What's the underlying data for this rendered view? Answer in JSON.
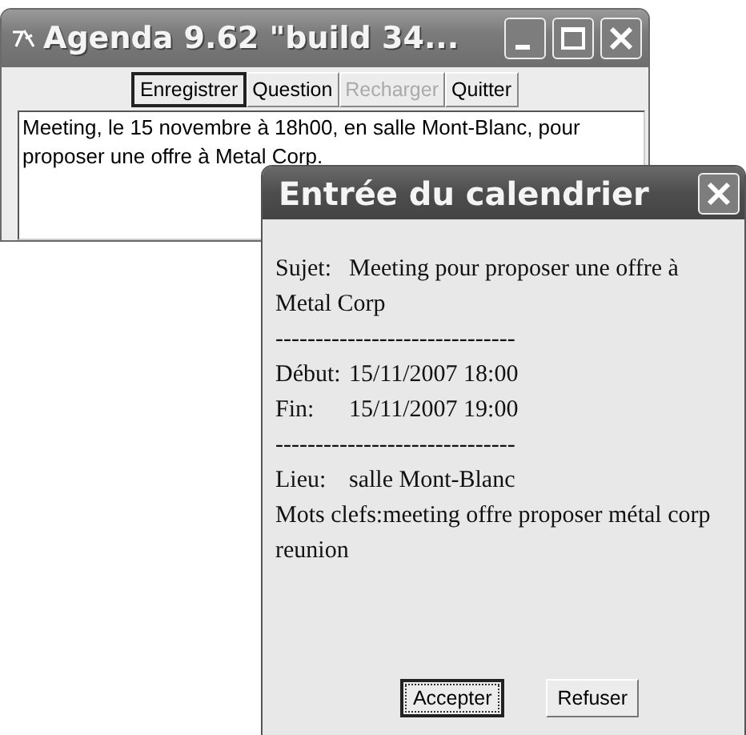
{
  "main_window": {
    "title": "Agenda 9.62 \"build 34...",
    "toolbar": [
      {
        "label": "Enregistrer",
        "focused": true,
        "disabled": false
      },
      {
        "label": "Question",
        "focused": false,
        "disabled": false
      },
      {
        "label": "Recharger",
        "focused": false,
        "disabled": true
      },
      {
        "label": "Quitter",
        "focused": false,
        "disabled": false
      }
    ],
    "text": "Meeting, le 15 novembre à 18h00, en salle Mont-Blanc, pour proposer une offre à Metal Corp."
  },
  "dialog": {
    "title": "Entrée du calendrier",
    "lines": [
      {
        "kind": "field",
        "label": "Sujet:",
        "value": "Meeting pour proposer une offre à Metal Corp"
      },
      {
        "kind": "separator",
        "text": "------------------------------"
      },
      {
        "kind": "field",
        "label": "Début:",
        "value": "15/11/2007 18:00"
      },
      {
        "kind": "field",
        "label": "Fin:",
        "value": "15/11/2007 19:00"
      },
      {
        "kind": "separator",
        "text": "------------------------------"
      },
      {
        "kind": "field",
        "label": "Lieu:",
        "value": "salle Mont-Blanc"
      },
      {
        "kind": "field",
        "label": "Mots clefs:",
        "value": "meeting offre proposer métal corp reunion"
      }
    ],
    "buttons": [
      {
        "label": "Accepter",
        "focused": true
      },
      {
        "label": "Refuser",
        "focused": false
      }
    ]
  }
}
